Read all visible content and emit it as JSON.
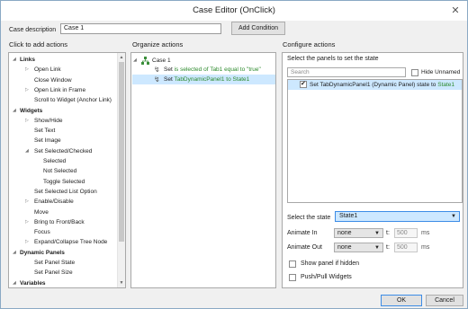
{
  "window": {
    "title": "Case Editor (OnClick)"
  },
  "case_description": {
    "label": "Case description",
    "value": "Case 1",
    "add_condition_label": "Add Condition"
  },
  "sections": {
    "left": "Click to add actions",
    "middle": "Organize actions",
    "right": "Configure actions"
  },
  "actions_tree": [
    {
      "label": "Links",
      "kind": "category",
      "expander": true
    },
    {
      "label": "Open Link",
      "kind": "item",
      "expander": true
    },
    {
      "label": "Close Window",
      "kind": "item",
      "expander": false
    },
    {
      "label": "Open Link in Frame",
      "kind": "item",
      "expander": true
    },
    {
      "label": "Scroll to Widget (Anchor Link)",
      "kind": "item",
      "expander": false
    },
    {
      "label": "Widgets",
      "kind": "category",
      "expander": true
    },
    {
      "label": "Show/Hide",
      "kind": "item",
      "expander": true
    },
    {
      "label": "Set Text",
      "kind": "item",
      "expander": false
    },
    {
      "label": "Set Image",
      "kind": "item",
      "expander": false
    },
    {
      "label": "Set Selected/Checked",
      "kind": "item",
      "expander": true
    },
    {
      "label": "Selected",
      "kind": "subitem",
      "expander": false
    },
    {
      "label": "Not Selected",
      "kind": "subitem",
      "expander": false
    },
    {
      "label": "Toggle Selected",
      "kind": "subitem",
      "expander": false
    },
    {
      "label": "Set Selected List Option",
      "kind": "item",
      "expander": false
    },
    {
      "label": "Enable/Disable",
      "kind": "item",
      "expander": true
    },
    {
      "label": "Move",
      "kind": "item",
      "expander": false
    },
    {
      "label": "Bring to Front/Back",
      "kind": "item",
      "expander": true
    },
    {
      "label": "Focus",
      "kind": "item",
      "expander": false
    },
    {
      "label": "Expand/Collapse Tree Node",
      "kind": "item",
      "expander": true
    },
    {
      "label": "Dynamic Panels",
      "kind": "category",
      "expander": true
    },
    {
      "label": "Set Panel State",
      "kind": "item",
      "expander": false
    },
    {
      "label": "Set Panel Size",
      "kind": "item",
      "expander": false
    },
    {
      "label": "Variables",
      "kind": "category",
      "expander": true
    }
  ],
  "organize": {
    "case_label": "Case 1",
    "action1": {
      "prefix": "Set ",
      "text": "is selected of Tab1 equal to \"true\""
    },
    "action2": {
      "prefix": "Set ",
      "text": "TabDynamicPanel1 to State1"
    }
  },
  "configure": {
    "select_panels_label": "Select the panels to set the state",
    "search_placeholder": "Search",
    "hide_unnamed_label": "Hide Unnamed",
    "panel_item": {
      "text": "Set TabDynamicPanel1 (Dynamic Panel) state to ",
      "state": "State1",
      "checked": true
    },
    "select_state_label": "Select the state",
    "select_state_value": "State1",
    "animate_in": {
      "label": "Animate In",
      "value": "none",
      "t_label": "t:",
      "t_value": "500",
      "unit": "ms"
    },
    "animate_out": {
      "label": "Animate Out",
      "value": "none",
      "t_label": "t:",
      "t_value": "500",
      "unit": "ms"
    },
    "show_panel_label": "Show panel if hidden",
    "push_pull_label": "Push/Pull Widgets"
  },
  "buttons": {
    "ok": "OK",
    "cancel": "Cancel"
  },
  "colors": {
    "selection": "#cde8ff",
    "accent": "#3c8ce6",
    "green_text": "#2c8a2c",
    "lightning": "#555555"
  }
}
